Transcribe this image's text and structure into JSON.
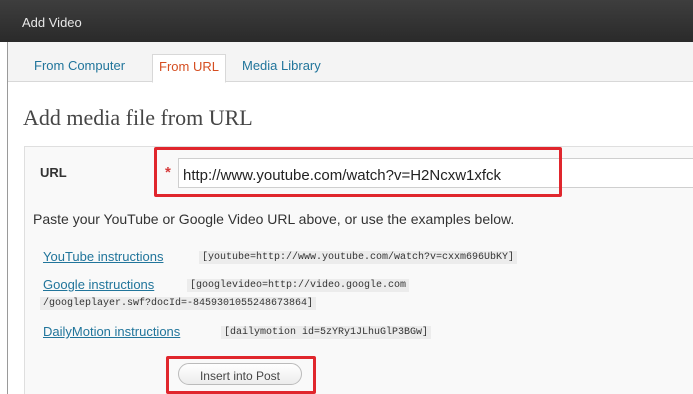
{
  "window": {
    "title": "Add Video"
  },
  "tabs": [
    {
      "label": "From Computer",
      "active": false
    },
    {
      "label": "From URL",
      "active": true
    },
    {
      "label": "Media Library",
      "active": false
    }
  ],
  "main": {
    "heading": "Add media file from URL",
    "url_label": "URL",
    "required_mark": "*",
    "url_value": "http://www.youtube.com/watch?v=H2Ncxw1xfck",
    "hint": "Paste your YouTube or Google Video URL above, or use the examples below.",
    "examples": [
      {
        "link": "YouTube instructions",
        "code": "[youtube=http://www.youtube.com/watch?v=cxxm696UbKY]"
      },
      {
        "link": "Google instructions",
        "code": "[googlevideo=http://video.google.com",
        "code2": "/googleplayer.swf?docId=-8459301055248673864]"
      },
      {
        "link": "DailyMotion instructions",
        "code": "[dailymotion id=5zYRy1JLhuGlP3BGw]"
      }
    ],
    "insert_button": "Insert into Post"
  },
  "colors": {
    "link": "#21759b",
    "active_tab": "#d54e21",
    "highlight": "#e0262d",
    "titlebar": "#333333"
  }
}
